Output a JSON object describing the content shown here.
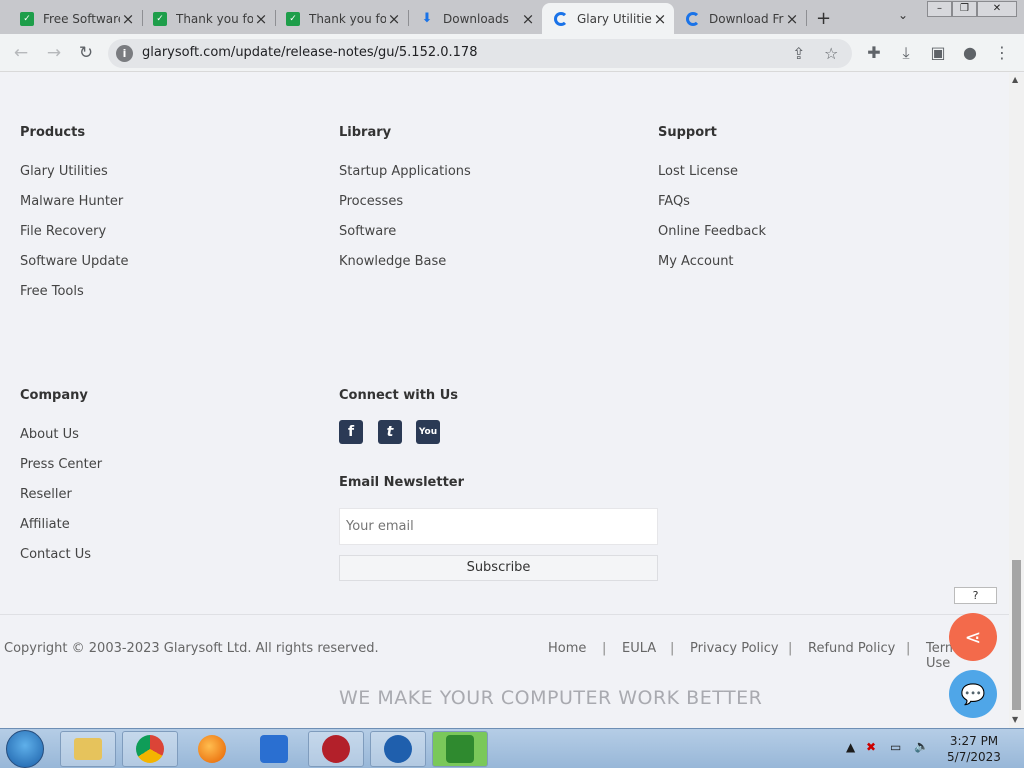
{
  "browser": {
    "tabs": [
      {
        "title": "Free Software",
        "favicon": "green-check-icon",
        "active": false
      },
      {
        "title": "Thank you fo",
        "favicon": "green-check-icon",
        "active": false
      },
      {
        "title": "Thank you fo",
        "favicon": "green-check-icon",
        "active": false
      },
      {
        "title": "Downloads",
        "favicon": "download-icon",
        "active": false
      },
      {
        "title": "Glary Utilitie",
        "favicon": "glary-icon",
        "active": true
      },
      {
        "title": "Download Fr",
        "favicon": "glary-icon",
        "active": false
      }
    ],
    "url": "glarysoft.com/update/release-notes/gu/5.152.0.178"
  },
  "footer": {
    "products": {
      "heading": "Products",
      "links": [
        "Glary Utilities",
        "Malware Hunter",
        "File Recovery",
        "Software Update",
        "Free Tools"
      ]
    },
    "library": {
      "heading": "Library",
      "links": [
        "Startup Applications",
        "Processes",
        "Software",
        "Knowledge Base"
      ]
    },
    "support": {
      "heading": "Support",
      "links": [
        "Lost License",
        "FAQs",
        "Online Feedback",
        "My Account"
      ]
    },
    "company": {
      "heading": "Company",
      "links": [
        "About Us",
        "Press Center",
        "Reseller",
        "Affiliate",
        "Contact Us"
      ]
    },
    "connect": {
      "heading": "Connect with Us",
      "social": [
        {
          "icon": "facebook-icon",
          "glyph": "f"
        },
        {
          "icon": "twitter-icon",
          "glyph": "t"
        },
        {
          "icon": "youtube-icon",
          "glyph": "You"
        }
      ]
    },
    "newsletter": {
      "heading": "Email Newsletter",
      "placeholder": "Your email",
      "subscribe_label": "Subscribe"
    },
    "copyright": "Copyright © 2003-2023 Glarysoft Ltd. All rights reserved.",
    "bottom_links": [
      "Home",
      "EULA",
      "Privacy Policy",
      "Refund Policy",
      "Terms of Use"
    ],
    "tagline": "WE MAKE YOUR COMPUTER WORK BETTER"
  },
  "widgets": {
    "help_label": "?"
  },
  "taskbar": {
    "time": "3:27 PM",
    "date": "5/7/2023"
  },
  "colors": {
    "share": "#f36a4b",
    "chat": "#4fa6e8",
    "social": "#2b3a55"
  }
}
